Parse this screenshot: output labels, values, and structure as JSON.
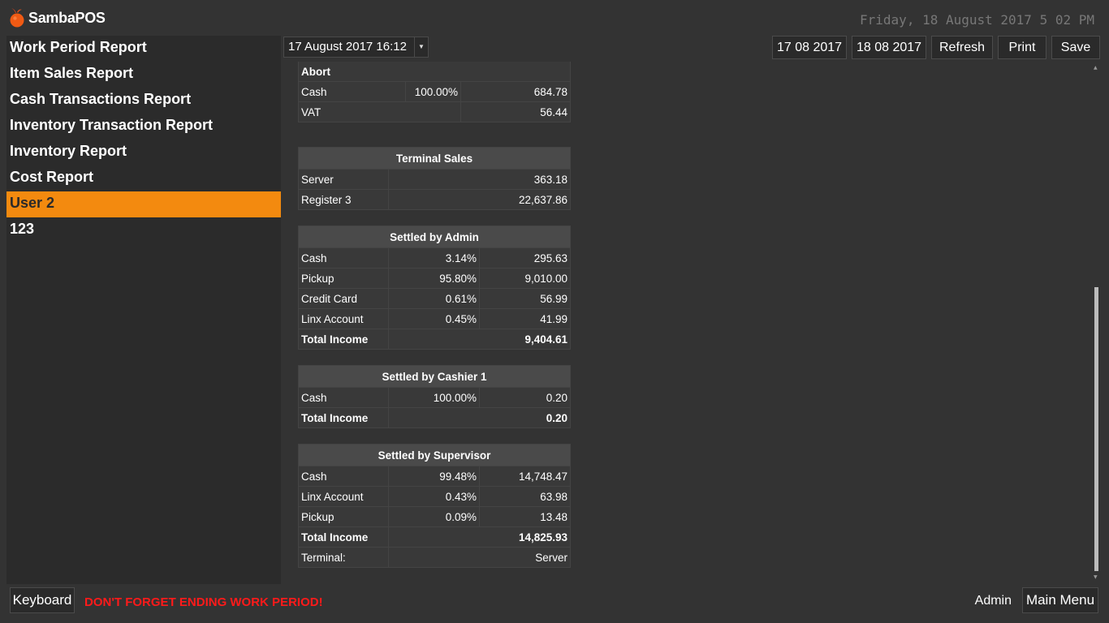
{
  "app": {
    "name": "SambaPOS",
    "clock": "Friday, 18 August 2017 5 02 PM"
  },
  "sidebar": {
    "items": [
      {
        "label": "Work Period Report"
      },
      {
        "label": "Item Sales Report"
      },
      {
        "label": "Cash Transactions Report"
      },
      {
        "label": "Inventory Transaction Report"
      },
      {
        "label": "Inventory Report"
      },
      {
        "label": "Cost Report"
      },
      {
        "label": "User 2",
        "active": true
      },
      {
        "label": "123"
      }
    ]
  },
  "toolbar": {
    "date_select": "17 August 2017 16:12",
    "start_date": "17 08 2017",
    "end_date": "18 08 2017",
    "refresh": "Refresh",
    "print": "Print",
    "save": "Save"
  },
  "report": {
    "abort": {
      "title": "Abort",
      "rows": [
        {
          "label": "Cash",
          "pct": "100.00%",
          "value": "684.78"
        },
        {
          "label": "VAT",
          "pct": "",
          "value": "56.44"
        }
      ]
    },
    "terminal_sales": {
      "title": "Terminal Sales",
      "rows": [
        {
          "label": "Server",
          "value": "363.18"
        },
        {
          "label": "Register 3",
          "value": "22,637.86"
        }
      ]
    },
    "settled_admin": {
      "title": "Settled by Admin",
      "rows": [
        {
          "label": "Cash",
          "pct": "3.14%",
          "value": "295.63"
        },
        {
          "label": "Pickup",
          "pct": "95.80%",
          "value": "9,010.00"
        },
        {
          "label": "Credit Card",
          "pct": "0.61%",
          "value": "56.99"
        },
        {
          "label": "Linx Account",
          "pct": "0.45%",
          "value": "41.99"
        }
      ],
      "total_label": "Total Income",
      "total_value": "9,404.61"
    },
    "settled_cashier": {
      "title": "Settled by Cashier 1",
      "rows": [
        {
          "label": "Cash",
          "pct": "100.00%",
          "value": "0.20"
        }
      ],
      "total_label": "Total Income",
      "total_value": "0.20"
    },
    "settled_supervisor": {
      "title": "Settled by Supervisor",
      "rows": [
        {
          "label": "Cash",
          "pct": "99.48%",
          "value": "14,748.47"
        },
        {
          "label": "Linx Account",
          "pct": "0.43%",
          "value": "63.98"
        },
        {
          "label": "Pickup",
          "pct": "0.09%",
          "value": "13.48"
        }
      ],
      "total_label": "Total Income",
      "total_value": "14,825.93",
      "terminal_label": "Terminal:",
      "terminal_value": "Server"
    }
  },
  "bottom": {
    "keyboard": "Keyboard",
    "warning": "DON'T FORGET ENDING WORK PERIOD!",
    "user": "Admin",
    "main_menu": "Main Menu"
  },
  "colors": {
    "accent": "#f38a0f",
    "warning": "#ff1a1a",
    "background": "#333333",
    "sidebar": "#2b2b2b"
  }
}
